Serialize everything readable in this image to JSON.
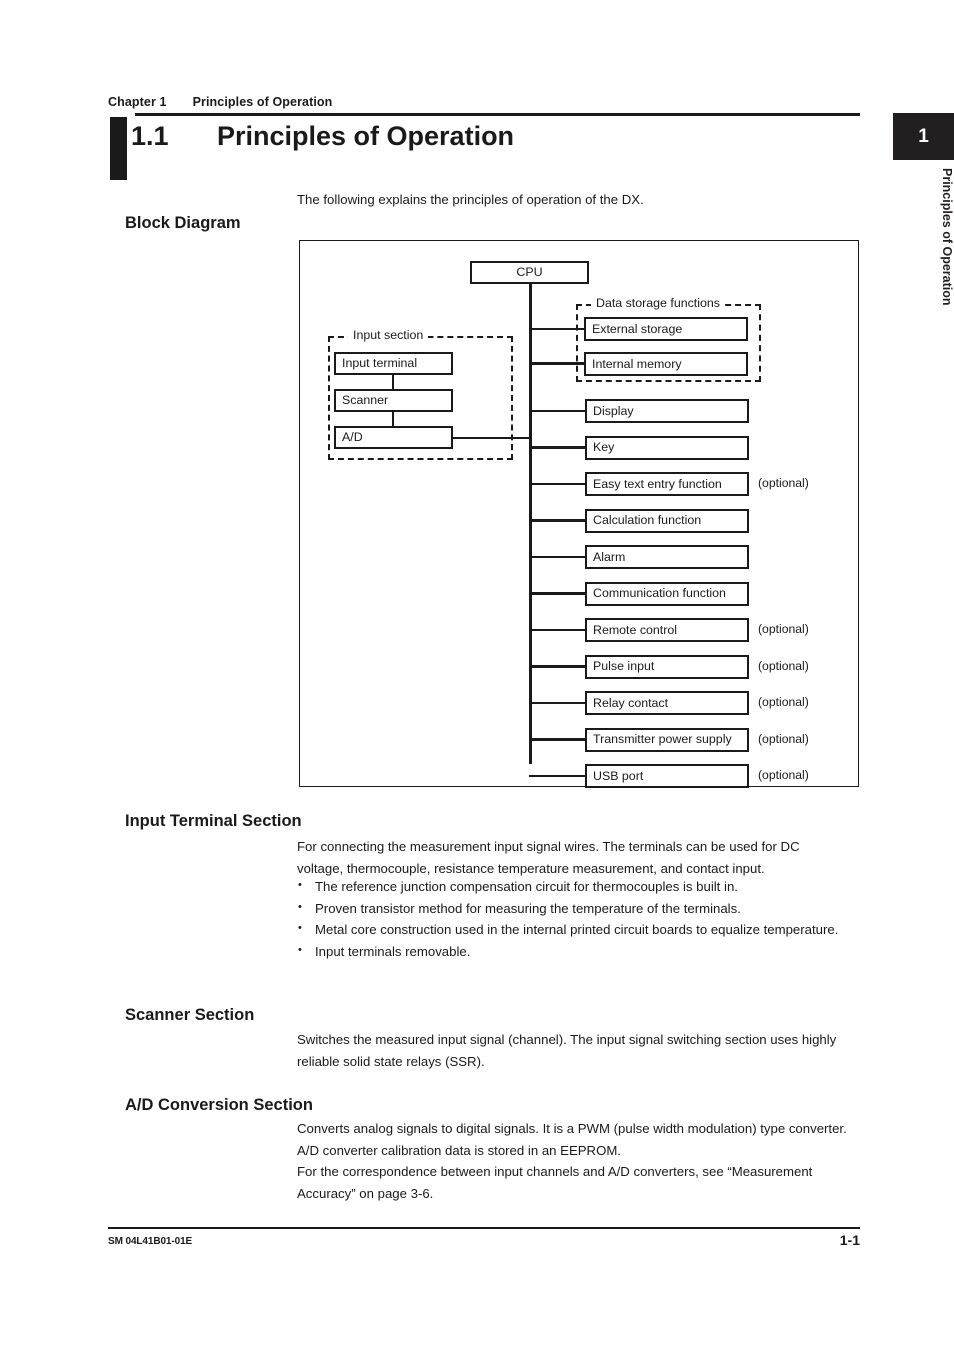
{
  "header": {
    "chapter_label": "Chapter 1",
    "chapter_title": "Principles of Operation"
  },
  "section": {
    "number": "1.1",
    "title": "Principles of Operation"
  },
  "chapter_tab": {
    "number": "1",
    "vertical_text": "Principles of Operation"
  },
  "intro": {
    "text": "The following explains the principles of operation of the DX."
  },
  "block_diagram": {
    "heading": "Block Diagram",
    "cpu": "CPU",
    "input_section_label": "Input  section",
    "input_section_nodes": [
      "Input terminal",
      "Scanner",
      "A/D"
    ],
    "data_storage_label": "Data  storage  functions",
    "data_storage_nodes": [
      "External storage",
      "Internal memory"
    ],
    "optional_note": "(optional)",
    "right_nodes": [
      {
        "label": "Display",
        "optional": false
      },
      {
        "label": "Key",
        "optional": false
      },
      {
        "label": "Easy text entry function",
        "optional": true
      },
      {
        "label": "Calculation  function",
        "optional": false
      },
      {
        "label": "Alarm",
        "optional": false
      },
      {
        "label": "Communication  function",
        "optional": false
      },
      {
        "label": "Remote control",
        "optional": true
      },
      {
        "label": "Pulse input",
        "optional": true
      },
      {
        "label": "Relay contact",
        "optional": true
      },
      {
        "label": "Transmitter power supply",
        "optional": true
      },
      {
        "label": "USB port",
        "optional": true
      }
    ]
  },
  "input_terminal_section": {
    "heading": "Input Terminal Section",
    "paragraph": "For connecting the measurement input signal wires. The terminals can be used for DC voltage, thermocouple, resistance temperature measurement, and contact input.",
    "bullets": [
      "The reference junction compensation circuit for thermocouples is built in.",
      "Proven transistor method for measuring the temperature of the terminals.",
      "Metal core construction used in the internal printed circuit boards to equalize temperature.",
      "Input terminals removable."
    ]
  },
  "scanner_section": {
    "heading": "Scanner Section",
    "paragraph": "Switches the measured input signal (channel). The input signal switching section uses highly reliable solid state relays (SSR)."
  },
  "ad_conversion_section": {
    "heading": "A/D Conversion Section",
    "paragraph_1": "Converts analog signals to digital signals. It is a PWM (pulse width modulation) type converter. A/D converter calibration data is stored in an EEPROM.",
    "paragraph_2": "For the correspondence between input channels and A/D converters, see “Measurement Accuracy” on page 3-6."
  },
  "footer": {
    "document_code": "SM 04L41B01-01E",
    "page_number": "1-1"
  }
}
